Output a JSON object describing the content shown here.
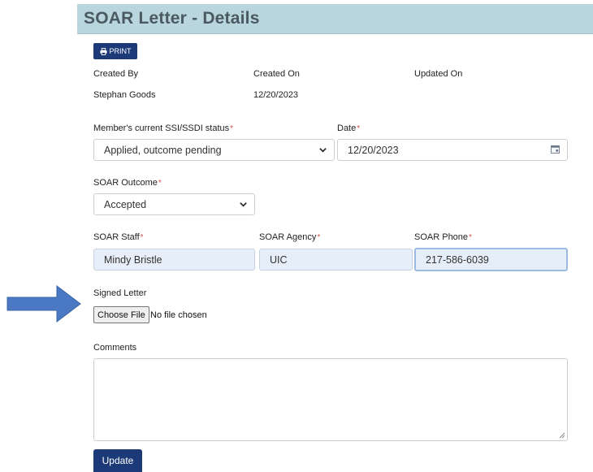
{
  "header": {
    "title": "SOAR Letter - Details"
  },
  "toolbar": {
    "print_label": "PRINT",
    "print_icon": "printer-icon"
  },
  "meta": {
    "created_by_label": "Created By",
    "created_on_label": "Created On",
    "updated_on_label": "Updated On",
    "created_by_value": "Stephan Goods",
    "created_on_value": "12/20/2023",
    "updated_on_value": ""
  },
  "form": {
    "required_mark": "*",
    "status": {
      "label": "Member's current SSI/SSDI status",
      "value": "Applied, outcome pending"
    },
    "date": {
      "label": "Date",
      "value": "12/20/2023"
    },
    "outcome": {
      "label": "SOAR Outcome",
      "value": "Accepted"
    },
    "staff": {
      "label": "SOAR Staff",
      "value": "Mindy Bristle"
    },
    "agency": {
      "label": "SOAR Agency",
      "value": "UIC"
    },
    "phone": {
      "label": "SOAR Phone",
      "value": "217-586-6039"
    },
    "signed_letter": {
      "label": "Signed Letter",
      "button_label": "Choose File",
      "status": "No file chosen"
    },
    "comments": {
      "label": "Comments",
      "value": ""
    },
    "update_label": "Update"
  },
  "colors": {
    "accent": "#1d3a78",
    "header_bg": "#b9d5dd",
    "required": "#d9534f",
    "arrow": "#4a78c2"
  }
}
